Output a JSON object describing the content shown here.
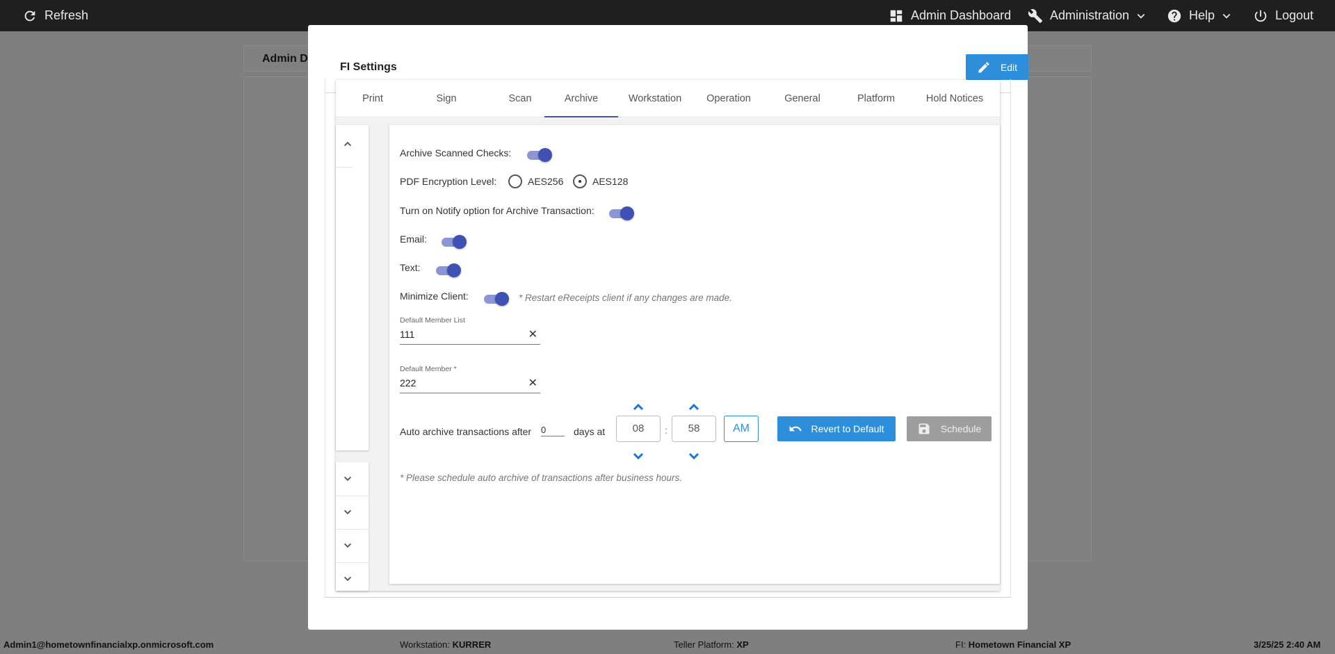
{
  "topbar": {
    "refresh": "Refresh",
    "admin_dashboard": "Admin Dashboard",
    "administration": "Administration",
    "help": "Help",
    "logout": "Logout"
  },
  "background": {
    "header_title": "Admin D"
  },
  "modal": {
    "title": "FI Settings",
    "edit_label": "Edit"
  },
  "tabs": [
    "Print",
    "Sign",
    "Scan",
    "Archive",
    "Workstation",
    "Operation",
    "General",
    "Platform",
    "Hold Notices"
  ],
  "active_tab": "Archive",
  "archive": {
    "archive_scanned_checks_label": "Archive Scanned Checks:",
    "archive_scanned_checks_on": true,
    "pdf_encryption_label": "PDF Encryption Level:",
    "encryption_options": [
      "AES256",
      "AES128"
    ],
    "encryption_selected": "AES128",
    "notify_label": "Turn on Notify option for Archive Transaction:",
    "notify_on": true,
    "email_label": "Email:",
    "email_on": true,
    "text_label": "Text:",
    "text_on": true,
    "minimize_label": "Minimize Client:",
    "minimize_on": true,
    "minimize_note": "* Restart eReceipts client if any changes are made.",
    "default_member_list_label": "Default Member List",
    "default_member_list_value": "111",
    "default_member_label": "Default Member *",
    "default_member_value": "222",
    "auto_archive_label": "Auto archive transactions after",
    "auto_archive_days": "0",
    "days_at_label": "days at",
    "hour": "08",
    "minute": "58",
    "time_sep": ":",
    "ampm": "AM",
    "revert_label": "Revert to Default",
    "schedule_label": "Schedule",
    "schedule_note": "* Please schedule auto archive of transactions after business hours."
  },
  "statusbar": {
    "user": "Admin1@hometownfinancialxp.onmicrosoft.com",
    "workstation_label": "Workstation:",
    "workstation_value": "KURRER",
    "platform_label": "Teller Platform:",
    "platform_value": "XP",
    "fi_label": "FI:",
    "fi_value": "Hometown Financial XP",
    "datetime": "3/25/25 2:40 AM"
  },
  "colors": {
    "accent": "#2d8fdc",
    "toggle": "#3f51b5",
    "topbar": "#1f1f1f"
  }
}
